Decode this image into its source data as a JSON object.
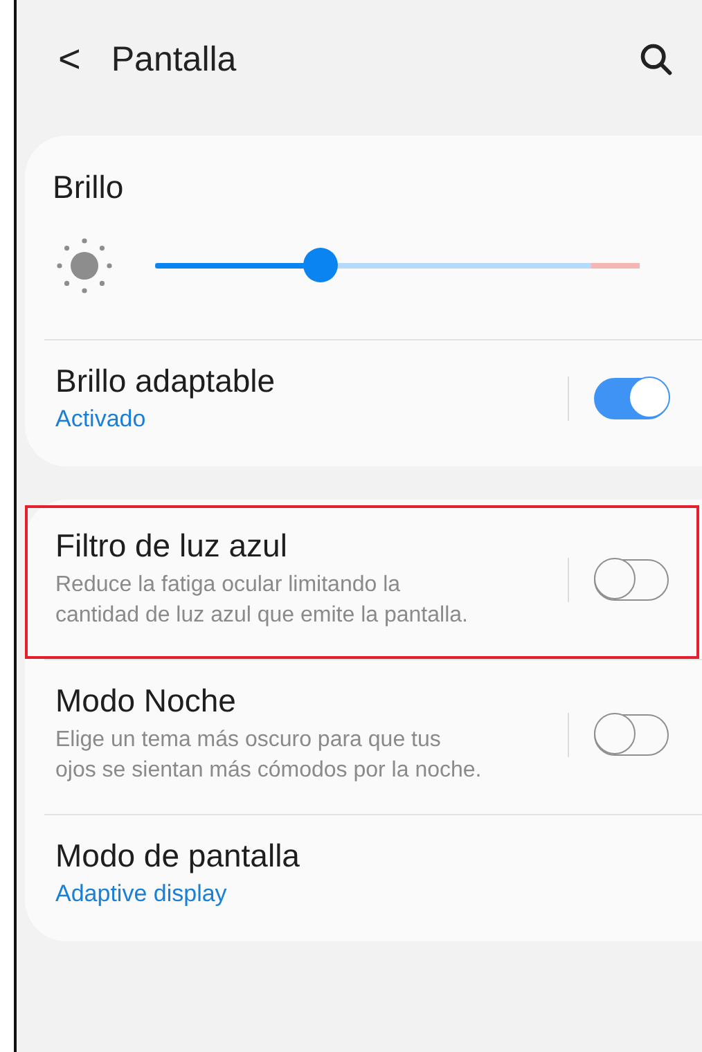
{
  "header": {
    "back": "<",
    "title": "Pantalla"
  },
  "brightness": {
    "title": "Brillo",
    "level": 0.34
  },
  "groups": [
    [
      {
        "kind": "switch",
        "title": "Brillo adaptable",
        "subtitle": "Activado",
        "on": true,
        "highlighted": false
      }
    ],
    [
      {
        "kind": "switch",
        "title": "Filtro de luz azul",
        "description": "Reduce la fatiga ocular limitando la cantidad de luz azul que emite la pantalla.",
        "on": false,
        "highlighted": true
      },
      {
        "kind": "switch",
        "title": "Modo Noche",
        "description": "Elige un tema más oscuro para que tus ojos se sientan más cómodos por la noche.",
        "on": false,
        "highlighted": false
      },
      {
        "kind": "link",
        "title": "Modo de pantalla",
        "subtitle": "Adaptive display",
        "highlighted": false
      }
    ]
  ]
}
